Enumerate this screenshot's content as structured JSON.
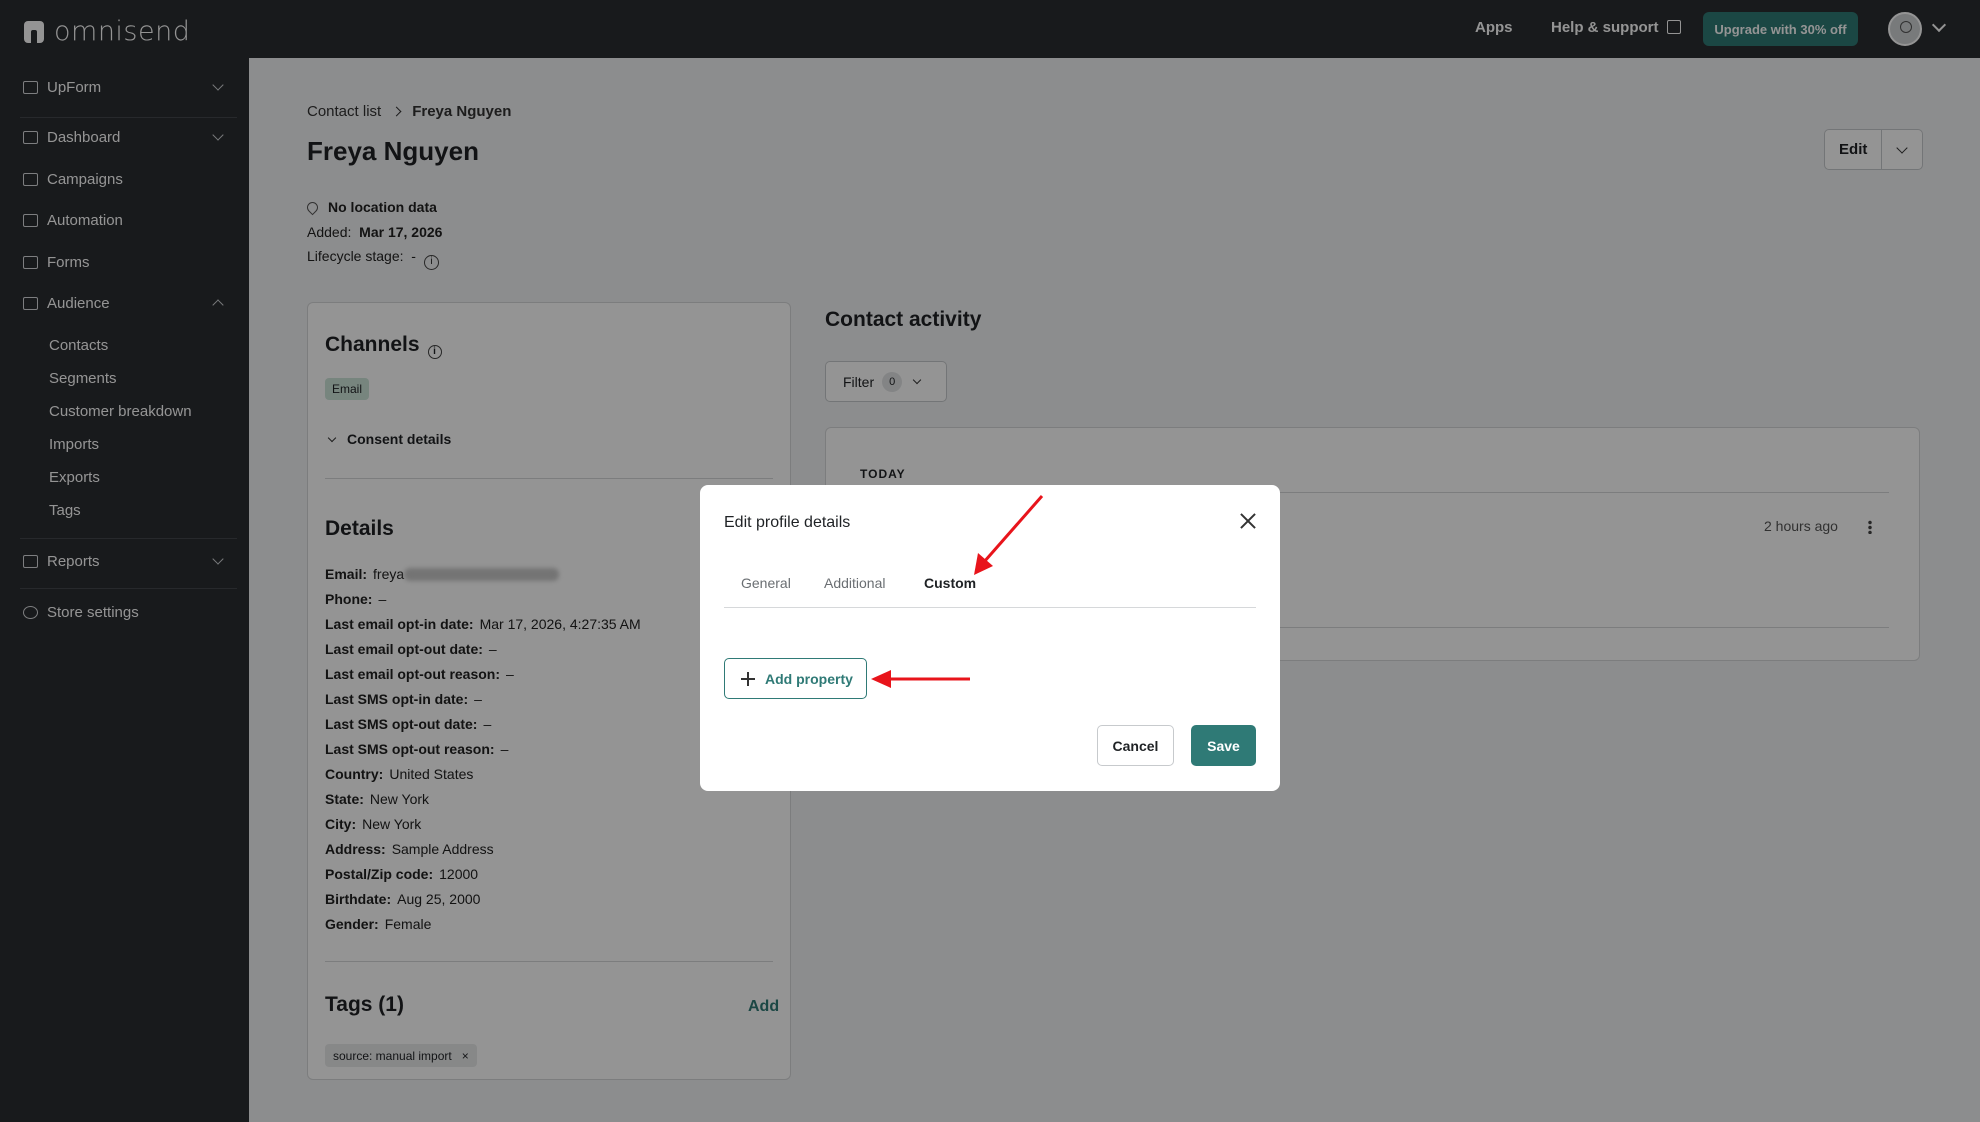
{
  "app": {
    "brand": "omnisend"
  },
  "topbar": {
    "apps_label": "Apps",
    "help_label": "Help & support",
    "upgrade_label": "Upgrade with 30% off"
  },
  "sidebar": {
    "items": [
      {
        "label": "UpForm",
        "icon": "form-icon",
        "caret": "down"
      },
      {
        "label": "Dashboard",
        "icon": "dashboard-icon",
        "caret": "down"
      },
      {
        "label": "Campaigns",
        "icon": "mail-icon"
      },
      {
        "label": "Automation",
        "icon": "automation-icon"
      },
      {
        "label": "Forms",
        "icon": "forms-icon"
      },
      {
        "label": "Audience",
        "icon": "people-icon",
        "caret": "up"
      },
      {
        "label": "Reports",
        "icon": "chart-icon",
        "caret": "down"
      },
      {
        "label": "Store settings",
        "icon": "gear-icon"
      }
    ],
    "audience_sub": [
      "Contacts",
      "Segments",
      "Customer breakdown",
      "Imports",
      "Exports",
      "Tags"
    ]
  },
  "breadcrumb": {
    "parent": "Contact list",
    "current": "Freya Nguyen"
  },
  "contact": {
    "name": "Freya Nguyen",
    "location": "No location data",
    "added_label": "Added:",
    "added_value": "Mar 17, 2026",
    "lifecycle_label": "Lifecycle stage:",
    "lifecycle_value": "-"
  },
  "header_actions": {
    "edit_label": "Edit"
  },
  "channels": {
    "title": "Channels",
    "chip": "Email",
    "consent_label": "Consent details"
  },
  "details": {
    "title": "Details",
    "rows": [
      {
        "k": "Email:",
        "v": "freya"
      },
      {
        "k": "Phone:",
        "v": "–"
      },
      {
        "k": "Last email opt-in date:",
        "v": "Mar 17, 2026, 4:27:35 AM"
      },
      {
        "k": "Last email opt-out date:",
        "v": "–"
      },
      {
        "k": "Last email opt-out reason:",
        "v": "–"
      },
      {
        "k": "Last SMS opt-in date:",
        "v": "–"
      },
      {
        "k": "Last SMS opt-out date:",
        "v": "–"
      },
      {
        "k": "Last SMS opt-out reason:",
        "v": "–"
      },
      {
        "k": "Country:",
        "v": "United States"
      },
      {
        "k": "State:",
        "v": "New York"
      },
      {
        "k": "City:",
        "v": "New York"
      },
      {
        "k": "Address:",
        "v": "Sample Address"
      },
      {
        "k": "Postal/Zip code:",
        "v": "12000"
      },
      {
        "k": "Birthdate:",
        "v": "Aug 25, 2000"
      },
      {
        "k": "Gender:",
        "v": "Female"
      }
    ]
  },
  "tags": {
    "title": "Tags (1)",
    "add_label": "Add",
    "chip": "source: manual import",
    "remove": "×"
  },
  "activity": {
    "title": "Contact activity",
    "filter_label": "Filter",
    "filter_count": "0",
    "section": "TODAY",
    "time": "2 hours ago"
  },
  "modal": {
    "title": "Edit profile details",
    "tabs": [
      "General",
      "Additional",
      "Custom"
    ],
    "active_tab": "Custom",
    "add_property_label": "Add property",
    "cancel_label": "Cancel",
    "save_label": "Save"
  },
  "colors": {
    "accent": "#2f7a76",
    "annotation": "#e8141b",
    "sidebar": "#2a2d31"
  }
}
